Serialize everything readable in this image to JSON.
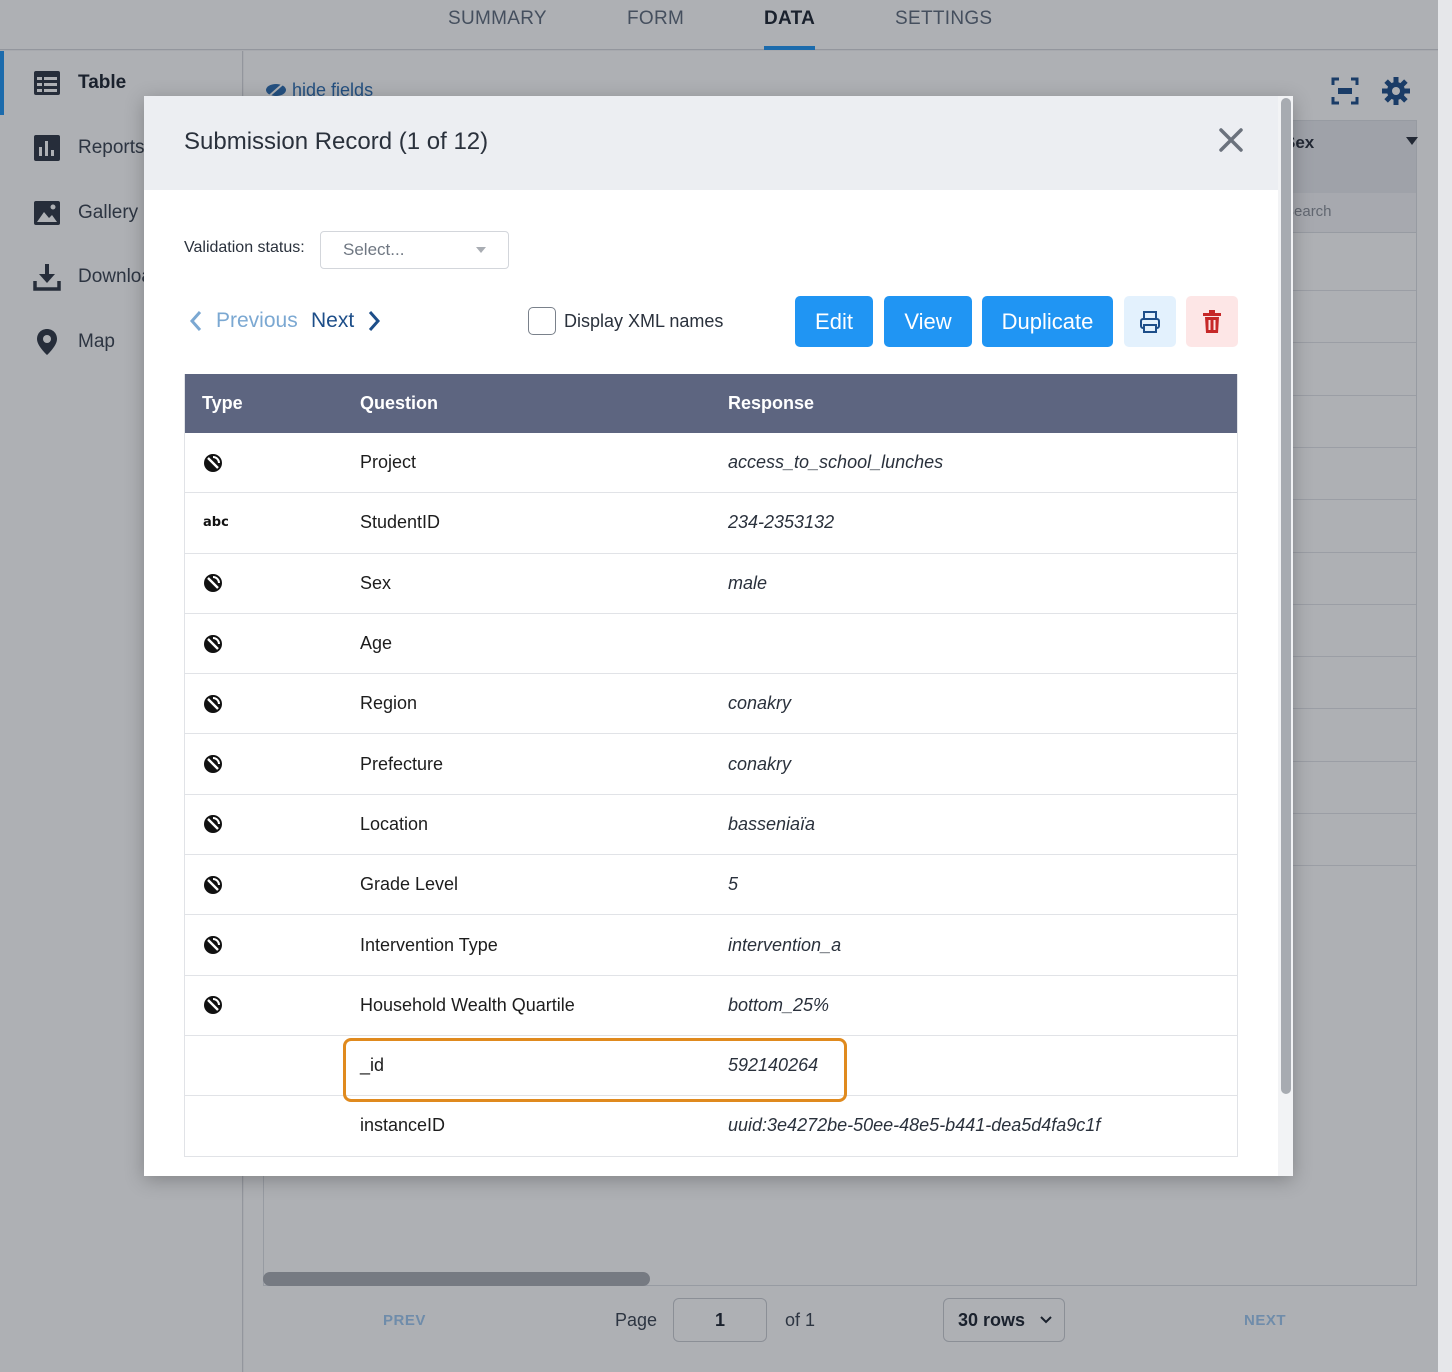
{
  "topnav": {
    "tabs": [
      {
        "label": "SUMMARY",
        "active": false
      },
      {
        "label": "FORM",
        "active": false
      },
      {
        "label": "DATA",
        "active": true
      },
      {
        "label": "SETTINGS",
        "active": false
      }
    ]
  },
  "sidebar": {
    "items": [
      {
        "label": "Table",
        "icon": "table-icon",
        "active": true
      },
      {
        "label": "Reports",
        "icon": "bar-chart-icon",
        "active": false
      },
      {
        "label": "Gallery",
        "icon": "image-icon",
        "active": false
      },
      {
        "label": "Downloads",
        "icon": "download-icon",
        "active": false
      },
      {
        "label": "Map",
        "icon": "map-pin-icon",
        "active": false
      }
    ]
  },
  "grid": {
    "hide_fields_label": "hide fields",
    "visible_column": "Sex",
    "filter_placeholder": "Search",
    "pager": {
      "prev": "PREV",
      "next": "NEXT",
      "page_label": "Page",
      "page_value": "1",
      "of_label": "of 1",
      "rows_option": "30 rows"
    }
  },
  "modal": {
    "title": "Submission Record (1 of 12)",
    "validation_label": "Validation status:",
    "validation_placeholder": "Select...",
    "previous_label": "Previous",
    "next_label": "Next",
    "display_xml_label": "Display XML names",
    "display_xml_checked": false,
    "buttons": {
      "edit": "Edit",
      "view": "View",
      "duplicate": "Duplicate"
    },
    "table": {
      "headers": {
        "type": "Type",
        "question": "Question",
        "response": "Response"
      },
      "rows": [
        {
          "type": "select-one-icon",
          "question": "Project",
          "response": "access_to_school_lunches"
        },
        {
          "type": "abc",
          "question": "StudentID",
          "response": "234-2353132"
        },
        {
          "type": "select-one-icon",
          "question": "Sex",
          "response": "male"
        },
        {
          "type": "select-one-icon",
          "question": "Age",
          "response": ""
        },
        {
          "type": "select-one-icon",
          "question": "Region",
          "response": "conakry"
        },
        {
          "type": "select-one-icon",
          "question": "Prefecture",
          "response": "conakry"
        },
        {
          "type": "select-one-icon",
          "question": "Location",
          "response": "basseniaïa"
        },
        {
          "type": "select-one-icon",
          "question": "Grade Level",
          "response": "5"
        },
        {
          "type": "select-one-icon",
          "question": "Intervention Type",
          "response": "intervention_a"
        },
        {
          "type": "select-one-icon",
          "question": "Household Wealth Quartile",
          "response": "bottom_25%"
        },
        {
          "type": "",
          "question": "_id",
          "response": "592140264"
        },
        {
          "type": "",
          "question": "instanceID",
          "response": "uuid:3e4272be-50ee-48e5-b441-dea5d4fa9c1f"
        }
      ]
    },
    "highlighted_row": "_id"
  },
  "colors": {
    "accent": "#2095f3",
    "table_header": "#5d6580",
    "highlight": "#e08a1e",
    "danger": "#c62828"
  }
}
